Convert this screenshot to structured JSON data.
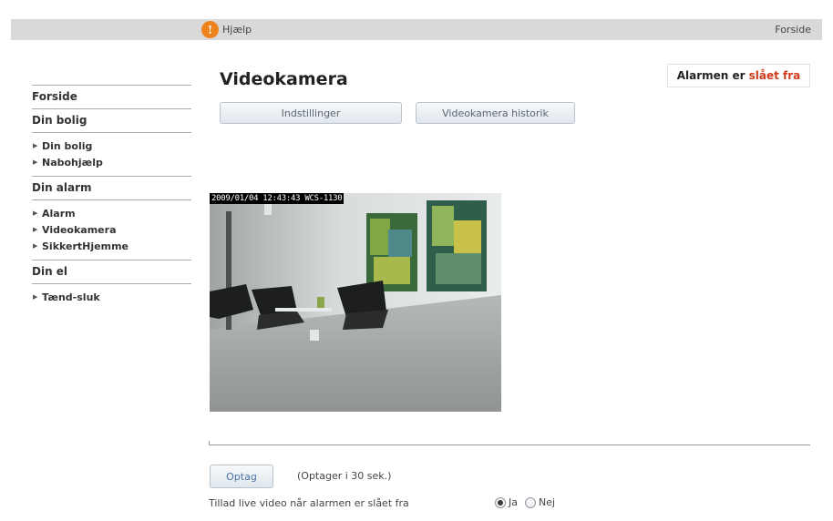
{
  "topbar": {
    "help_label": "Hjælp",
    "help_icon": "!",
    "home_link": "Forside"
  },
  "page": {
    "title": "Videokamera"
  },
  "alarm_status": {
    "prefix": "Alarmen er",
    "state": "slået fra",
    "state_color": "#d13a1a"
  },
  "buttons": {
    "settings": "Indstillinger",
    "history": "Videokamera historik"
  },
  "sidebar": {
    "home": "Forside",
    "sections": [
      {
        "title": "Din bolig",
        "items": [
          "Din bolig",
          "Nabohjælp"
        ]
      },
      {
        "title": "Din alarm",
        "items": [
          "Alarm",
          "Videokamera",
          "SikkertHjemme"
        ]
      },
      {
        "title": "Din el",
        "items": [
          "Tænd-sluk"
        ]
      }
    ]
  },
  "video": {
    "overlay": "2009/01/04 12:43:43 WCS-1130"
  },
  "record": {
    "button": "Optag",
    "note": "(Optager i 30 sek.)"
  },
  "live_video": {
    "label": "Tillad live video når alarmen er slået fra",
    "options": [
      "Ja",
      "Nej"
    ],
    "selected": "Ja"
  },
  "colors": {
    "accent": "#f0821e",
    "alarm_off": "#d13a1a"
  }
}
